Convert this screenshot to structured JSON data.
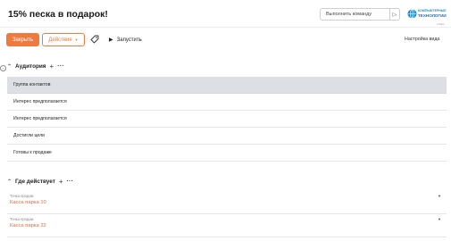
{
  "header": {
    "title": "15% песка в подарок!",
    "command_placeholder": "Выполнить команду",
    "logo": {
      "line1": "КОМПЬЮТЕРНЫЕ",
      "line2": "ТЕХНОЛОГИИ",
      "sub": "LOGO"
    }
  },
  "toolbar": {
    "close_label": "Закрыть",
    "actions_label": "Действия",
    "run_label": "Запустить",
    "view_settings_label": "Настройка вида"
  },
  "audience": {
    "title": "Аудитория",
    "rows": [
      "Группа контактов",
      "Интерес предполагается",
      "Интерес предполагается",
      "Достигли цели",
      "Готовы к продаже"
    ]
  },
  "where": {
    "title": "Где действует",
    "fields": [
      {
        "label": "Точка продаж",
        "value": "Касса парка 10"
      },
      {
        "label": "Точка продаж",
        "value": "Касса парка 22"
      }
    ]
  },
  "colors": {
    "accent": "#f07a3e",
    "link": "#e8663a",
    "selected_row": "#dedfe4",
    "brand_blue": "#1e88c8"
  }
}
